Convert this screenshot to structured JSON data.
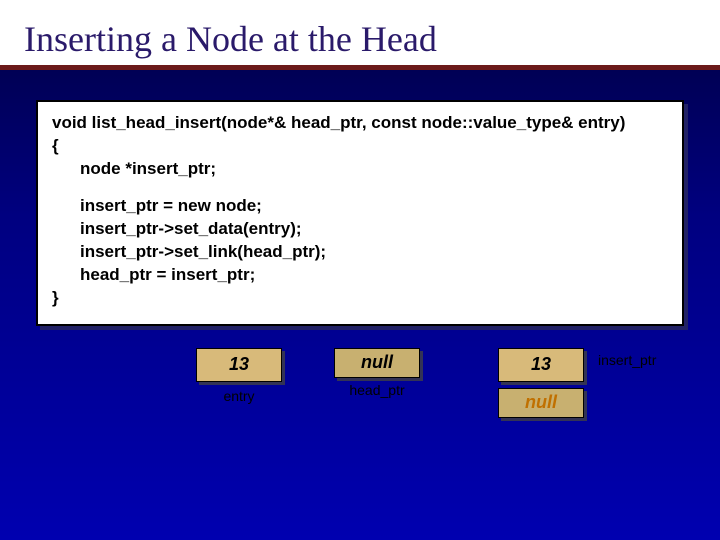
{
  "title": "Inserting a Node at the Head",
  "code": {
    "sig": "void list_head_insert(node*& head_ptr, const node::value_type& entry)",
    "open": "{",
    "decl": "node *insert_ptr;",
    "l1": "insert_ptr = new node;",
    "l2": "insert_ptr->set_data(entry);",
    "l3": "insert_ptr->set_link(head_ptr);",
    "l4": "head_ptr = insert_ptr;",
    "close": "}"
  },
  "diagram": {
    "entry": {
      "value": "13",
      "label": "entry"
    },
    "head": {
      "value": "null",
      "label": "head_ptr"
    },
    "node": {
      "data": "13",
      "link": "null",
      "ptr_label": "insert_ptr"
    }
  }
}
